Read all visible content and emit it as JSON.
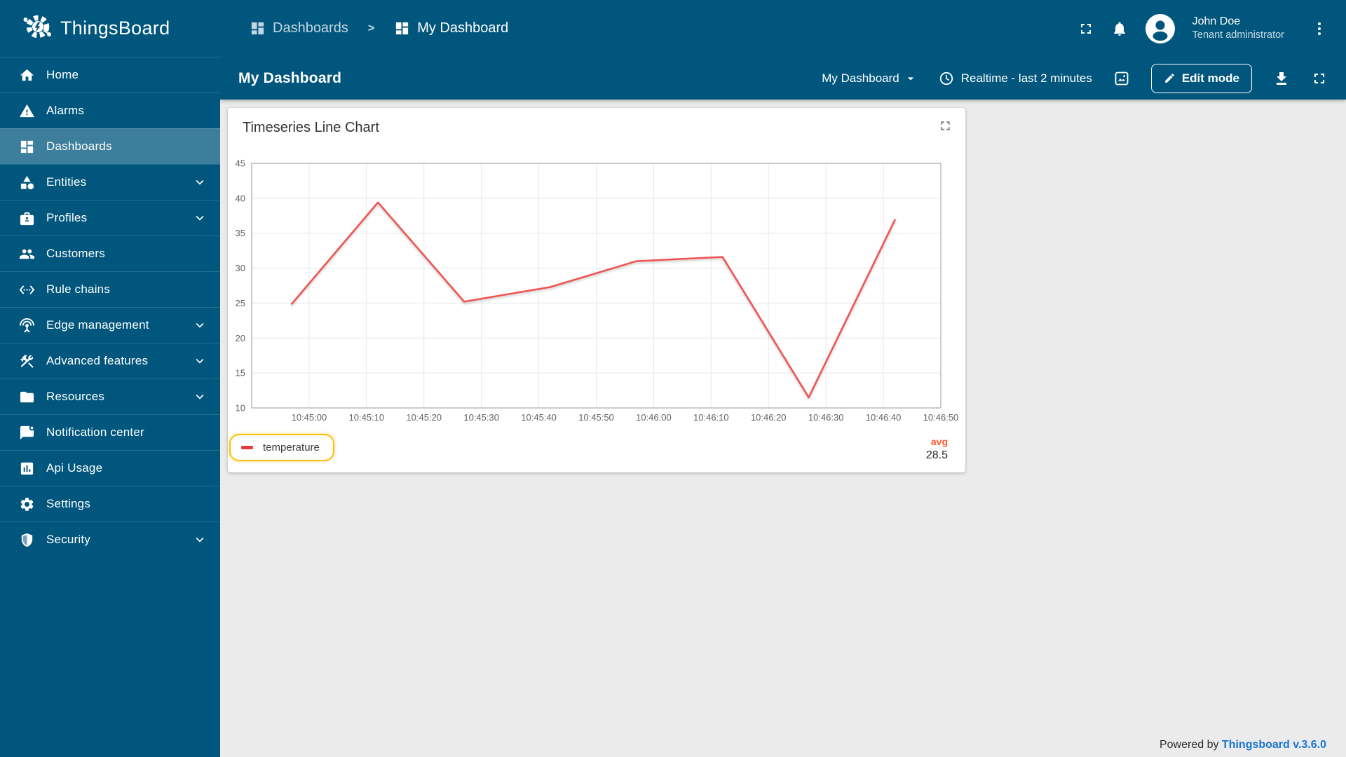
{
  "app": {
    "name": "ThingsBoard"
  },
  "colors": {
    "primary": "#01567D",
    "line": "#f0524f",
    "legend_dash": "#e8393d",
    "legend_highlight": "#ffc107",
    "avg_label": "#ff5b30",
    "link": "#1976d2"
  },
  "sidebar": {
    "items": [
      {
        "label": "Home",
        "icon": "home-icon",
        "active": false,
        "expandable": false
      },
      {
        "label": "Alarms",
        "icon": "alarms-icon",
        "active": false,
        "expandable": false
      },
      {
        "label": "Dashboards",
        "icon": "dashboards-icon",
        "active": true,
        "expandable": false
      },
      {
        "label": "Entities",
        "icon": "entities-icon",
        "active": false,
        "expandable": true
      },
      {
        "label": "Profiles",
        "icon": "profiles-icon",
        "active": false,
        "expandable": true
      },
      {
        "label": "Customers",
        "icon": "customers-icon",
        "active": false,
        "expandable": false
      },
      {
        "label": "Rule chains",
        "icon": "rule-chains-icon",
        "active": false,
        "expandable": false
      },
      {
        "label": "Edge management",
        "icon": "edge-management-icon",
        "active": false,
        "expandable": true
      },
      {
        "label": "Advanced features",
        "icon": "advanced-features-icon",
        "active": false,
        "expandable": true
      },
      {
        "label": "Resources",
        "icon": "resources-icon",
        "active": false,
        "expandable": true
      },
      {
        "label": "Notification center",
        "icon": "notification-center-icon",
        "active": false,
        "expandable": false
      },
      {
        "label": "Api Usage",
        "icon": "api-usage-icon",
        "active": false,
        "expandable": false
      },
      {
        "label": "Settings",
        "icon": "settings-icon",
        "active": false,
        "expandable": false
      },
      {
        "label": "Security",
        "icon": "security-icon",
        "active": false,
        "expandable": true
      }
    ]
  },
  "header": {
    "breadcrumb": {
      "parent": "Dashboards",
      "separator": ">",
      "current": "My Dashboard"
    },
    "icons": [
      "fullscreen-icon",
      "notifications-bell-icon",
      "avatar",
      "more-vert-icon"
    ],
    "user": {
      "name": "John Doe",
      "role": "Tenant administrator"
    }
  },
  "toolbar": {
    "page_title": "My Dashboard",
    "dashboard_select": "My Dashboard",
    "timewindow": "Realtime - last 2 minutes",
    "edit_button": "Edit mode",
    "icons": [
      "clock-icon",
      "image-icon",
      "edit-pencil-icon",
      "download-icon",
      "fullscreen-icon"
    ]
  },
  "widget": {
    "title": "Timeseries Line Chart",
    "legend": {
      "label": "temperature"
    },
    "aggregation": {
      "label": "avg",
      "value": "28.5"
    }
  },
  "footer": {
    "powered_by": "Powered by ",
    "link": "Thingsboard v.3.6.0"
  },
  "chart_data": {
    "type": "line",
    "title": "Timeseries Line Chart",
    "x_range": [
      "10:44:50",
      "10:46:50"
    ],
    "x_ticks": [
      "10:45:00",
      "10:45:10",
      "10:45:20",
      "10:45:30",
      "10:45:40",
      "10:45:50",
      "10:46:00",
      "10:46:10",
      "10:46:20",
      "10:46:30",
      "10:46:40",
      "10:46:50"
    ],
    "y_range": [
      10,
      45
    ],
    "y_ticks": [
      10,
      15,
      20,
      25,
      30,
      35,
      40,
      45
    ],
    "grid": true,
    "legend_position": "bottom-left",
    "series": [
      {
        "name": "temperature",
        "color": "#f0524f",
        "points": [
          [
            "10:44:57",
            24.9
          ],
          [
            "10:45:12",
            39.4
          ],
          [
            "10:45:27",
            25.2
          ],
          [
            "10:45:42",
            27.3
          ],
          [
            "10:45:57",
            31.0
          ],
          [
            "10:46:12",
            31.6
          ],
          [
            "10:46:27",
            11.5
          ],
          [
            "10:46:42",
            36.9
          ]
        ]
      }
    ],
    "avg": 28.5
  }
}
